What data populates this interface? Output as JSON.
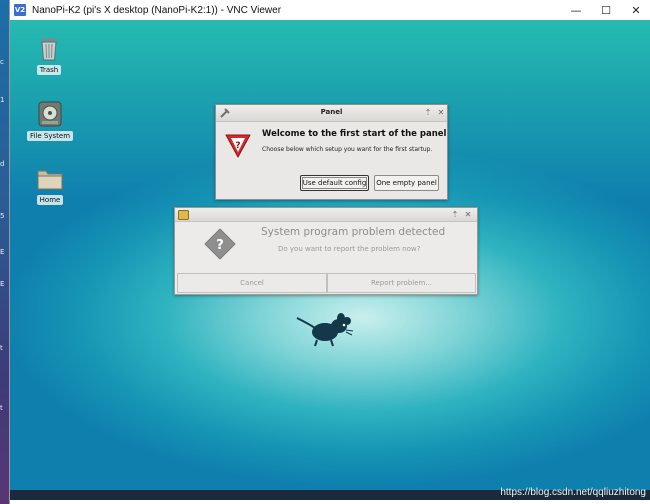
{
  "host": {
    "strip_marks": [
      "c",
      "1",
      "d",
      "5",
      "E",
      "E",
      "t",
      "t"
    ]
  },
  "window": {
    "title": "NanoPi-K2 (pi's X desktop (NanoPi-K2:1)) - VNC Viewer",
    "logo": "V2",
    "minimize_glyph": "—",
    "maximize_glyph": "☐",
    "close_glyph": "✕"
  },
  "desktop": {
    "icons": [
      {
        "label": "Trash"
      },
      {
        "label": "File System"
      },
      {
        "label": "Home"
      }
    ]
  },
  "panel_dialog": {
    "title": "Panel",
    "heading": "Welcome to the first start of the panel",
    "body": "Choose below which setup you want for the first startup.",
    "default_button": "Use default config",
    "empty_button": "One empty panel"
  },
  "problem_dialog": {
    "heading": "System program problem detected",
    "body": "Do you want to report the problem now?",
    "cancel_button": "Cancel",
    "report_button": "Report problem..."
  },
  "watermark": "https://blog.csdn.net/qqliuzhitong",
  "colors": {
    "desktop_teal": "#1fb3b6",
    "dialog_bg": "#e9e8e6",
    "warning_red": "#d42a2a",
    "vnc_blue": "#3a6fcf"
  }
}
